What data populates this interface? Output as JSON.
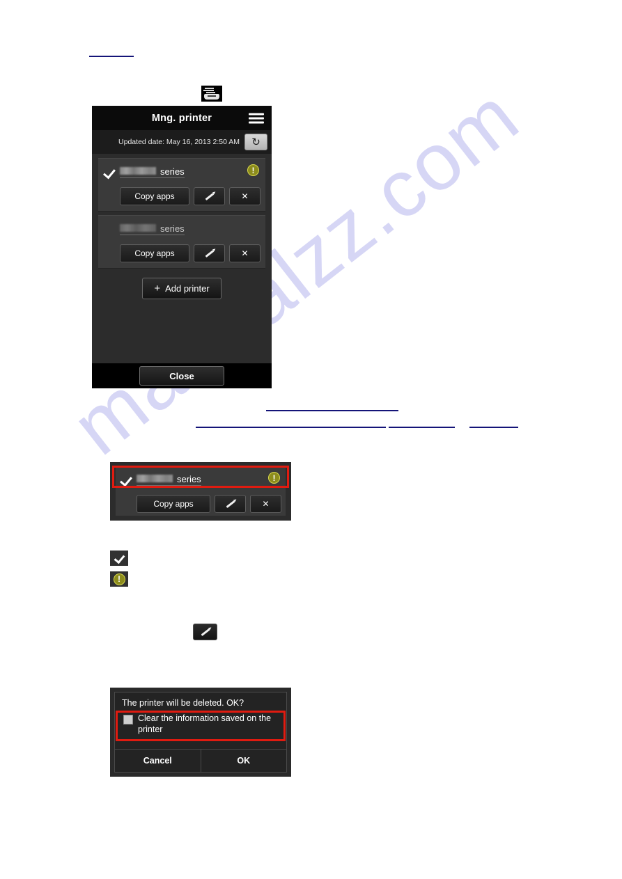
{
  "watermark": {
    "text": "manualzz.com"
  },
  "device_icon": {
    "name": "printer-device-icon"
  },
  "panel": {
    "title": "Mng. printer",
    "menu_icon": "hamburger-menu-icon",
    "updated_label": "Updated date: May 16, 2013 2:50 AM",
    "refresh_icon": "↻",
    "printers": [
      {
        "checked": true,
        "name_redacted": true,
        "series_label": "series",
        "status_icon": "!",
        "copy_apps_label": "Copy apps",
        "edit_icon": "pencil-icon",
        "delete_icon": "✕"
      },
      {
        "checked": false,
        "name_redacted": true,
        "series_label": "series",
        "copy_apps_label": "Copy apps",
        "edit_icon": "pencil-icon",
        "delete_icon": "✕"
      }
    ],
    "add_printer": {
      "plus": "+",
      "label": "Add printer"
    },
    "close_label": "Close"
  },
  "callout": {
    "series_label": "series",
    "status_icon": "!",
    "copy_apps_label": "Copy apps",
    "delete_icon": "✕"
  },
  "legend": {
    "check_icon": "check-icon",
    "warn_icon": "!",
    "pencil_icon": "pencil-icon"
  },
  "confirm_dialog": {
    "question": "The printer will be deleted. OK?",
    "option_label": "Clear the information saved on the printer",
    "option_checked": false,
    "cancel_label": "Cancel",
    "ok_label": "OK"
  },
  "colors": {
    "link": "#141478",
    "highlight_outline": "#e01b10",
    "panel_bg": "#2c2c2c",
    "card_bg": "#3a3a3a",
    "warning": "#8c8c1c",
    "watermark": "#d6d6f5"
  }
}
